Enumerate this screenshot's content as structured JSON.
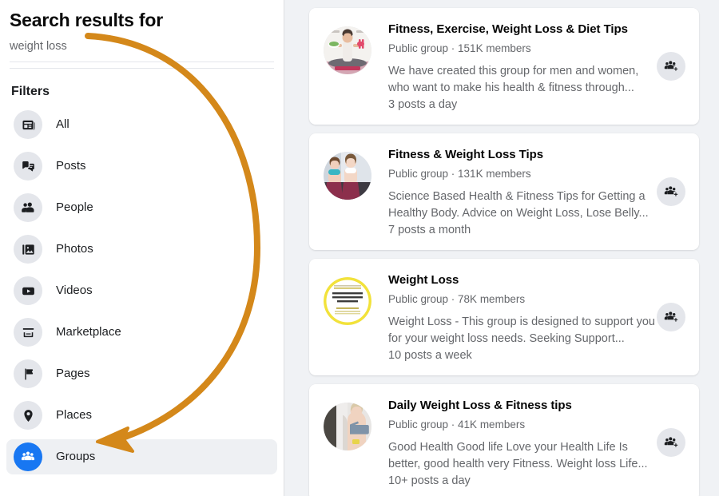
{
  "header": {
    "title": "Search results for",
    "query": "weight loss"
  },
  "sidebar": {
    "filters_heading": "Filters",
    "items": [
      {
        "label": "All",
        "icon": "all-icon",
        "selected": false
      },
      {
        "label": "Posts",
        "icon": "posts-icon",
        "selected": false
      },
      {
        "label": "People",
        "icon": "people-icon",
        "selected": false
      },
      {
        "label": "Photos",
        "icon": "photos-icon",
        "selected": false
      },
      {
        "label": "Videos",
        "icon": "videos-icon",
        "selected": false
      },
      {
        "label": "Marketplace",
        "icon": "marketplace-icon",
        "selected": false
      },
      {
        "label": "Pages",
        "icon": "pages-icon",
        "selected": false
      },
      {
        "label": "Places",
        "icon": "places-icon",
        "selected": false
      },
      {
        "label": "Groups",
        "icon": "groups-icon",
        "selected": true
      }
    ]
  },
  "results": {
    "cards": [
      {
        "title": "Fitness, Exercise, Weight Loss & Diet Tips",
        "privacy": "Public group",
        "members": "151K members",
        "meta": "Public group · 151K members",
        "description": "We have created this group for men and women, who want to make his health & fitness through...",
        "activity": "3 posts a day",
        "join_label": "join-group",
        "avatar": "woman-salad-dumbbell"
      },
      {
        "title": "Fitness & Weight Loss Tips",
        "privacy": "Public group",
        "members": "131K members",
        "meta": "Public group · 131K members",
        "description": "Science Based Health & Fitness Tips for Getting a Healthy Body. Advice on Weight Loss, Lose Belly...",
        "activity": "7 posts a month",
        "join_label": "join-group",
        "avatar": "two-women-fitness"
      },
      {
        "title": "Weight Loss",
        "privacy": "Public group",
        "members": "78K members",
        "meta": "Public group · 78K members",
        "description": "Weight Loss - This group is designed to support you for your weight loss needs. Seeking Support...",
        "activity": "10 posts a week",
        "join_label": "join-group",
        "avatar": "yellow-quote-card"
      },
      {
        "title": "Daily Weight Loss & Fitness tips",
        "privacy": "Public group",
        "members": "41K members",
        "meta": "Public group · 41K members",
        "description": "Good Health Good life Love your Health Life Is better, good health very Fitness. Weight loss Life...",
        "activity": "10+ posts a day",
        "join_label": "join-group",
        "avatar": "woman-sports-bra"
      }
    ]
  },
  "annotation": {
    "type": "curved-arrow",
    "color": "#d4881a",
    "points_to": "Groups"
  },
  "colors": {
    "accent_blue": "#1877f2",
    "annotation_orange": "#d4881a",
    "page_bg": "#f0f2f5",
    "card_bg": "#ffffff",
    "icon_bg": "#e4e6eb",
    "text_primary": "#050505",
    "text_secondary": "#65676b",
    "selected_row_bg": "#eef0f3"
  }
}
